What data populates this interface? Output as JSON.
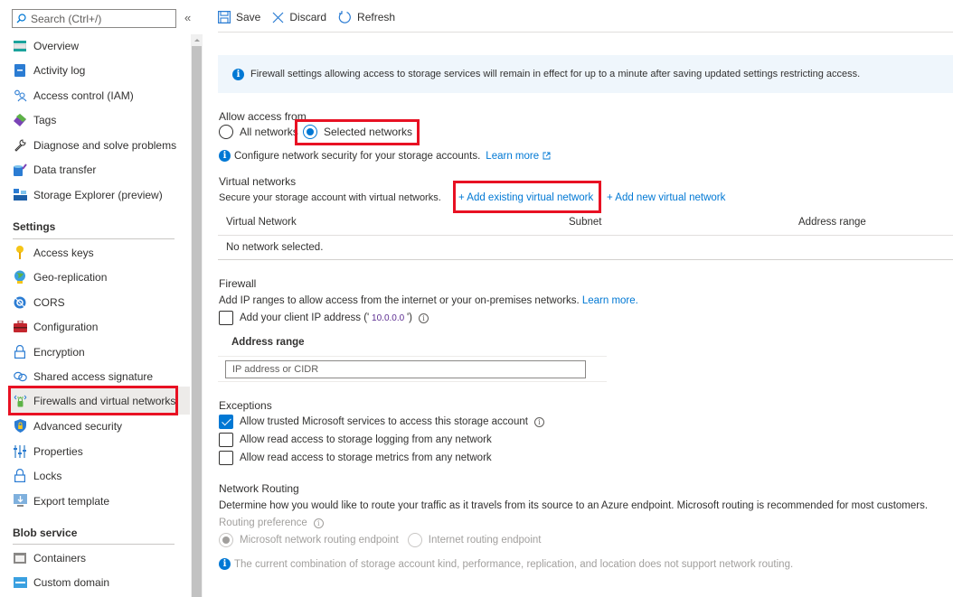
{
  "sidebar": {
    "search_placeholder": "Search (Ctrl+/)",
    "collapse_icon": "«",
    "items_top": [
      {
        "label": "Overview",
        "icon": "overview-icon"
      },
      {
        "label": "Activity log",
        "icon": "activity-log-icon"
      },
      {
        "label": "Access control (IAM)",
        "icon": "people-icon"
      },
      {
        "label": "Tags",
        "icon": "tag-icon"
      },
      {
        "label": "Diagnose and solve problems",
        "icon": "wrench-icon"
      },
      {
        "label": "Data transfer",
        "icon": "data-transfer-icon"
      },
      {
        "label": "Storage Explorer (preview)",
        "icon": "storage-explorer-icon"
      }
    ],
    "settings_header": "Settings",
    "settings_items": [
      {
        "label": "Access keys",
        "icon": "key-icon"
      },
      {
        "label": "Geo-replication",
        "icon": "globe-icon"
      },
      {
        "label": "CORS",
        "icon": "cors-icon"
      },
      {
        "label": "Configuration",
        "icon": "toolbox-icon"
      },
      {
        "label": "Encryption",
        "icon": "lock-icon"
      },
      {
        "label": "Shared access signature",
        "icon": "link-icon"
      },
      {
        "label": "Firewalls and virtual networks",
        "icon": "firewall-icon",
        "active": true
      },
      {
        "label": "Advanced security",
        "icon": "shield-icon"
      },
      {
        "label": "Properties",
        "icon": "properties-icon"
      },
      {
        "label": "Locks",
        "icon": "lock-icon"
      },
      {
        "label": "Export template",
        "icon": "export-icon"
      }
    ],
    "blob_header": "Blob service",
    "blob_items": [
      {
        "label": "Containers",
        "icon": "container-icon"
      },
      {
        "label": "Custom domain",
        "icon": "domain-icon"
      }
    ]
  },
  "toolbar": {
    "save_label": "Save",
    "discard_label": "Discard",
    "refresh_label": "Refresh"
  },
  "banner": {
    "text": "Firewall settings allowing access to storage services will remain in effect for up to a minute after saving updated settings restricting access."
  },
  "access": {
    "title": "Allow access from",
    "options": [
      "All networks",
      "Selected networks"
    ],
    "selected": "Selected networks",
    "info_text": "Configure network security for your storage accounts.",
    "learn_more": "Learn more"
  },
  "virtual_networks": {
    "title": "Virtual networks",
    "description": "Secure your storage account with virtual networks.",
    "add_existing": "+ Add existing virtual network",
    "add_new": "+ Add new virtual network",
    "columns": [
      "Virtual Network",
      "Subnet",
      "Address range"
    ],
    "empty_text": "No network selected."
  },
  "firewall": {
    "title": "Firewall",
    "description": "Add IP ranges to allow access from the internet or your on-premises networks.",
    "learn_more": "Learn more.",
    "client_ip_label": "Add your client IP address ('",
    "client_ip_value": " 10.0.0.0 ",
    "client_ip_suffix": "')",
    "client_ip_checked": false,
    "address_range_header": "Address range",
    "ip_placeholder": "IP address or CIDR"
  },
  "exceptions": {
    "title": "Exceptions",
    "items": [
      {
        "label": "Allow trusted Microsoft services to access this storage account",
        "checked": true,
        "info": true
      },
      {
        "label": "Allow read access to storage logging from any network",
        "checked": false
      },
      {
        "label": "Allow read access to storage metrics from any network",
        "checked": false
      }
    ]
  },
  "routing": {
    "title": "Network Routing",
    "description": "Determine how you would like to route your traffic as it travels from its source to an Azure endpoint. Microsoft routing is recommended for most customers.",
    "preference_label": "Routing preference",
    "options": [
      "Microsoft network routing endpoint",
      "Internet routing endpoint"
    ],
    "selected": "Microsoft network routing endpoint",
    "disabled": true,
    "note": "The current combination of storage account kind, performance, replication, and location does not support network routing."
  },
  "colors": {
    "accent": "#0078d4",
    "highlight_border": "#e81123",
    "banner_bg": "#eff6fc"
  }
}
